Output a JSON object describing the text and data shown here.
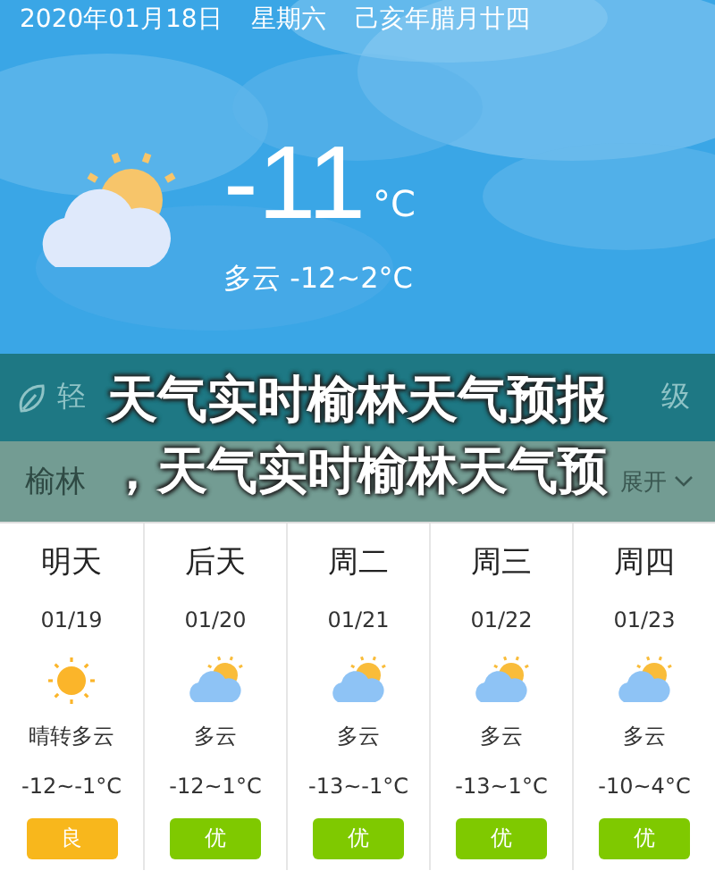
{
  "header": {
    "date": "2020年01月18日",
    "weekday": "星期六",
    "lunar": "己亥年腊月廿四",
    "temperature": "-11",
    "unit": "°C",
    "summary": "多云 -12~2°C",
    "kind": "partly-cloudy"
  },
  "air_bar": {
    "label": "轻",
    "level_text": "级"
  },
  "forecast_header": {
    "title": "榆林",
    "toggle": "展开"
  },
  "overlay_title": [
    "天气实时榆林天气预报",
    "，天气实时榆林天气预"
  ],
  "days": [
    {
      "day": "明天",
      "date": "01/19",
      "kind": "sunny",
      "desc": "晴转多云",
      "temp": "-12~-1°C",
      "aqi": "良",
      "color": "#f8b71c"
    },
    {
      "day": "后天",
      "date": "01/20",
      "kind": "partly-cloudy",
      "desc": "多云",
      "temp": "-12~1°C",
      "aqi": "优",
      "color": "#7fc900"
    },
    {
      "day": "周二",
      "date": "01/21",
      "kind": "partly-cloudy",
      "desc": "多云",
      "temp": "-13~-1°C",
      "aqi": "优",
      "color": "#7fc900"
    },
    {
      "day": "周三",
      "date": "01/22",
      "kind": "partly-cloudy",
      "desc": "多云",
      "temp": "-13~1°C",
      "aqi": "优",
      "color": "#7fc900"
    },
    {
      "day": "周四",
      "date": "01/23",
      "kind": "partly-cloudy",
      "desc": "多云",
      "temp": "-10~4°C",
      "aqi": "优",
      "color": "#7fc900"
    }
  ]
}
